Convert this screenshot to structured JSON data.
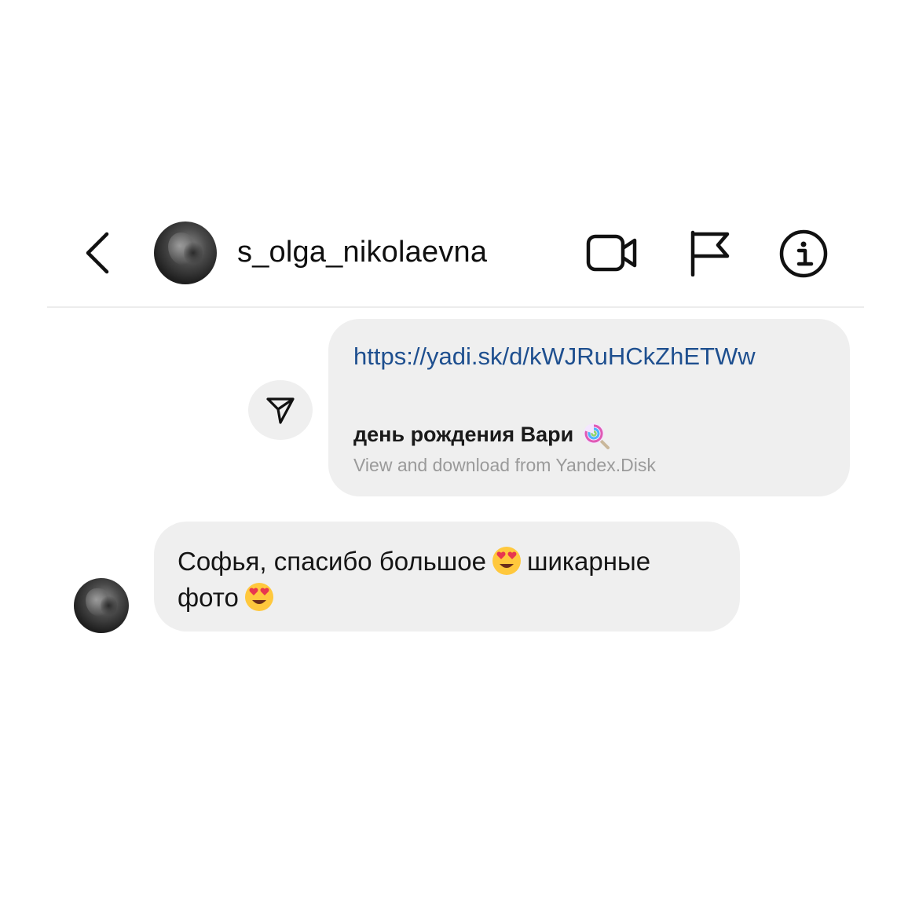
{
  "header": {
    "username": "s_olga_nikolaevna",
    "back_icon": "chevron-left-icon",
    "video_icon": "video-camera-icon",
    "flag_icon": "flag-icon",
    "info_icon": "info-icon"
  },
  "messages": {
    "outgoing_link": {
      "url": "https://yadi.sk/d/kWJRuHCkZhETWw",
      "preview_title": "день рождения Вари",
      "preview_emoji": "lollipop-icon",
      "preview_subtitle": "View and download from Yandex.Disk",
      "share_icon": "paper-plane-icon"
    },
    "incoming": {
      "part1": "Софья, спасибо большое",
      "part2": "шикарные",
      "part3": "фото",
      "emoji": "heart-eyes-icon"
    }
  },
  "colors": {
    "link": "#1e4f8f",
    "bubble": "#efefef",
    "subtitle": "#9a9a9a"
  }
}
